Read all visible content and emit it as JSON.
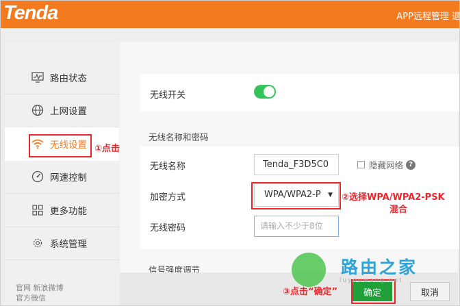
{
  "header": {
    "logo": "Tenda",
    "link": "APP远程管理 退"
  },
  "sidebar": {
    "items": [
      {
        "label": "路由状态",
        "icon": "monitor-icon"
      },
      {
        "label": "上网设置",
        "icon": "globe-icon"
      },
      {
        "label": "无线设置",
        "icon": "wifi-icon",
        "active": true
      },
      {
        "label": "网速控制",
        "icon": "speedometer-icon"
      },
      {
        "label": "更多功能",
        "icon": "grid-icon"
      },
      {
        "label": "系统管理",
        "icon": "gear-icon"
      }
    ],
    "footer_line1": "官网  新浪微博",
    "footer_line2": "官方微信"
  },
  "main": {
    "wireless_switch_label": "无线开关",
    "wireless_switch_on": true,
    "section_name_pwd": "无线名称和密码",
    "ssid_label": "无线名称",
    "ssid_value": "Tenda_F3D5C0",
    "hide_ssid_label": "隐藏网络",
    "help_glyph": "?",
    "encryption_label": "加密方式",
    "encryption_value": "WPA/WPA2-P",
    "password_label": "无线密码",
    "password_placeholder": "请输入不少于8位",
    "section_signal": "信号强度调节"
  },
  "buttons": {
    "ok": "确定",
    "cancel": "取消"
  },
  "annotations": {
    "step1": "①点击",
    "step2_line1": "②选择WPA/WPA2-PSK",
    "step2_line2": "混合",
    "step3": "③点击“确定”"
  },
  "watermark": {
    "text": "路由之家",
    "url": "luyouwang.net"
  },
  "colors": {
    "brand": "#f37a1f",
    "toggle_on": "#34c25a",
    "ok_button": "#20a039",
    "annotation": "#e8262b"
  }
}
